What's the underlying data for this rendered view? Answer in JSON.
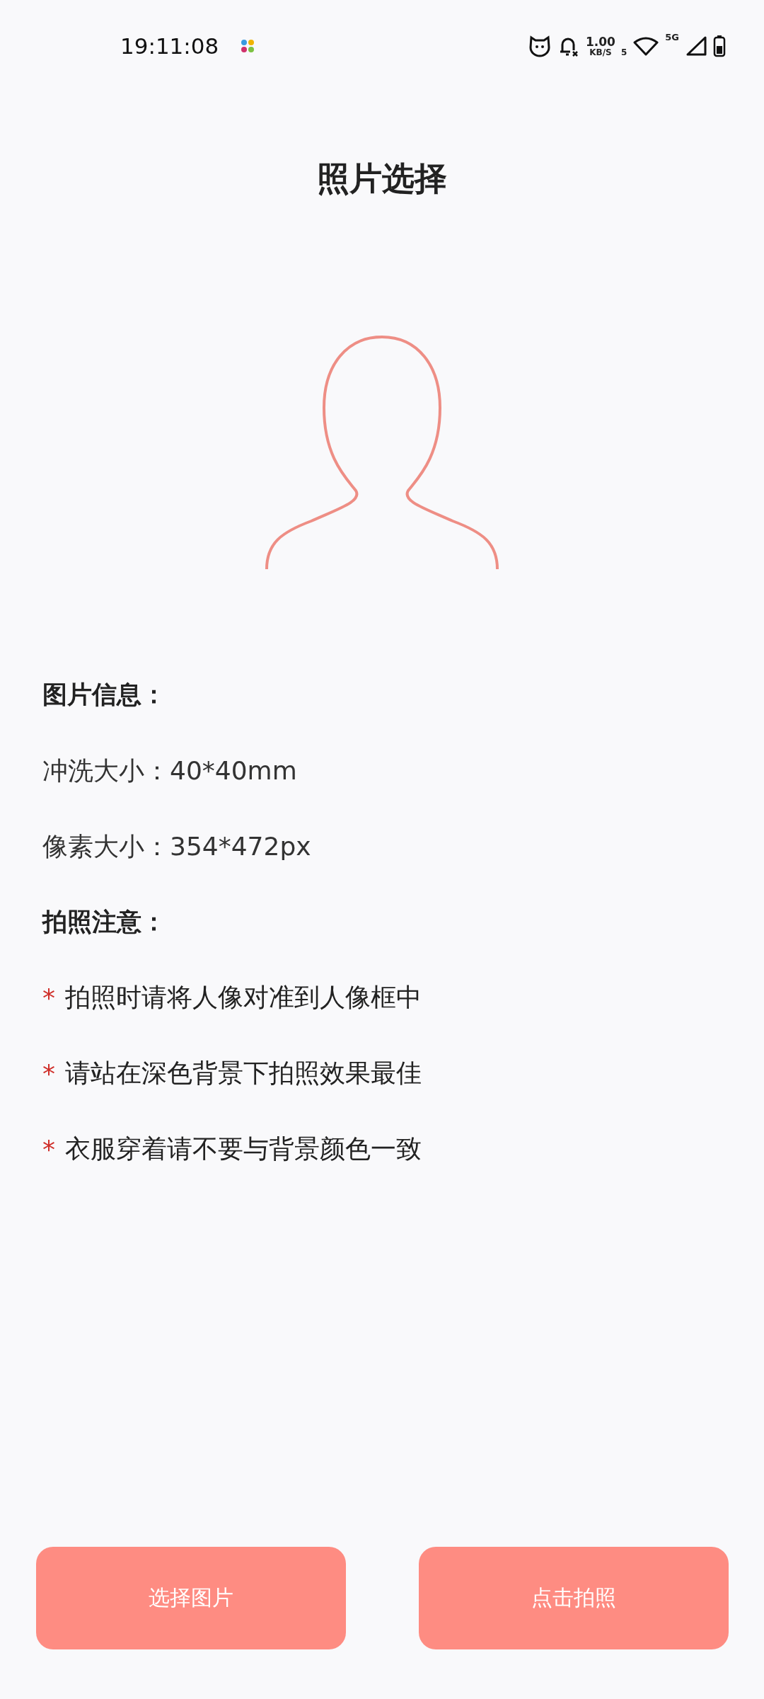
{
  "status_bar": {
    "time": "19:11:08",
    "net_speed": "1.00",
    "net_unit": "KB/S",
    "wifi_badge": "5",
    "signal_badge": "5G"
  },
  "title": "照片选择",
  "info": {
    "heading": "图片信息：",
    "fields": [
      {
        "label": "冲洗大小：",
        "value": "40*40mm"
      },
      {
        "label": "像素大小：",
        "value": "354*472px"
      }
    ]
  },
  "notes": {
    "heading": "拍照注意：",
    "items": [
      {
        "marker": "*",
        "text": "拍照时请将人像对准到人像框中"
      },
      {
        "marker": "*",
        "text": "请站在深色背景下拍照效果最佳"
      },
      {
        "marker": "*",
        "text": "衣服穿着请不要与背景颜色一致"
      }
    ]
  },
  "buttons": [
    "选择图片",
    "点击拍照"
  ]
}
